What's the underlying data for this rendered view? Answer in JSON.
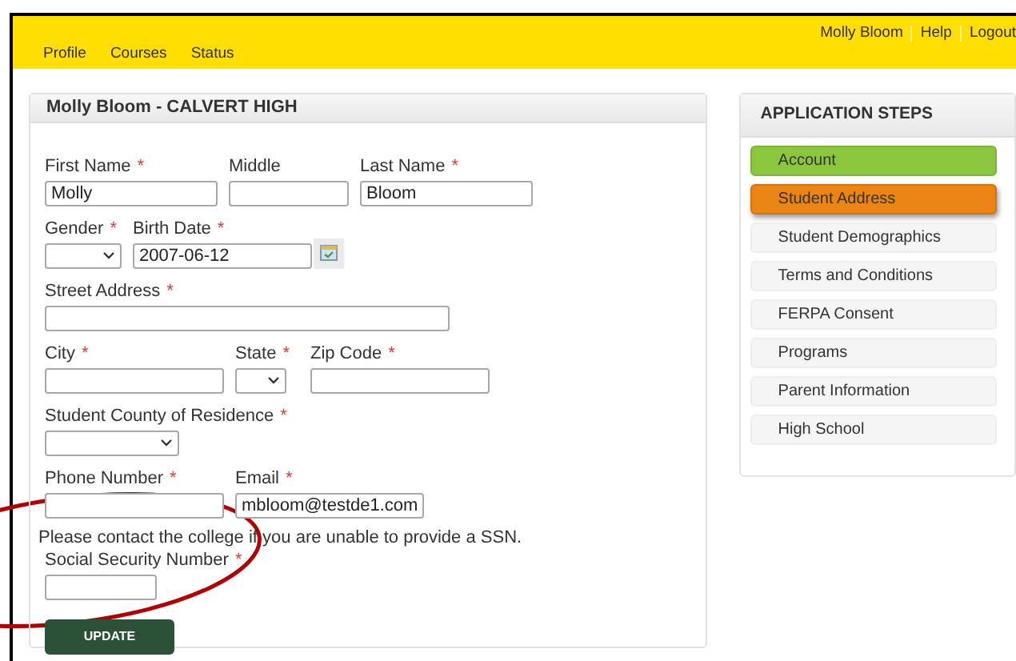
{
  "nav": {
    "links": [
      "Profile",
      "Courses",
      "Status"
    ],
    "user_links": [
      "Molly Bloom",
      "Help",
      "Logout"
    ]
  },
  "form": {
    "title": "Molly Bloom - CALVERT HIGH",
    "rows": [
      {
        "fields": [
          {
            "label": "First Name",
            "required": true,
            "kind": "text",
            "value": "Molly"
          },
          {
            "label": "Middle",
            "required": false,
            "kind": "text"
          },
          {
            "label": "Last Name",
            "required": true,
            "kind": "text",
            "value": "Bloom"
          }
        ]
      },
      {
        "fields": [
          {
            "label": "Gender",
            "required": true,
            "kind": "select"
          },
          {
            "label": "Birth Date",
            "required": true,
            "kind": "date",
            "value": "2007-06-12"
          }
        ]
      },
      {
        "fields": [
          {
            "label": "Street Address",
            "required": true,
            "kind": "text"
          }
        ]
      },
      {
        "fields": [
          {
            "label": "City",
            "required": true,
            "kind": "text"
          },
          {
            "label": "State",
            "required": true,
            "kind": "select"
          },
          {
            "label": "Zip Code",
            "required": true,
            "kind": "text"
          }
        ]
      },
      {
        "fields": [
          {
            "label": "Student County of Residence",
            "required": true,
            "kind": "select"
          }
        ]
      },
      {
        "fields": [
          {
            "label": "Phone Number",
            "required": true,
            "kind": "text"
          },
          {
            "label": "Email",
            "required": true,
            "kind": "text",
            "value": "mbloom@testde1.com"
          }
        ]
      },
      {
        "note": "Please contact the college if you are unable to provide a SSN.",
        "fields": [
          {
            "label": "Social Security Number",
            "required": true,
            "kind": "text"
          }
        ]
      }
    ],
    "required_mark": "*",
    "button": "UPDATE"
  },
  "steps": {
    "title": "APPLICATION STEPS",
    "items": [
      {
        "label": "Account",
        "complete": true,
        "selected": false
      },
      {
        "label": "Student Address",
        "selected": true
      },
      {
        "label": "Student Demographics",
        "complete": false,
        "selected": false
      },
      {
        "label": "Terms and Conditions",
        "complete": false,
        "selected": false
      },
      {
        "label": "FERPA Consent",
        "complete": false,
        "selected": false
      },
      {
        "label": "Programs",
        "complete": false,
        "selected": false
      },
      {
        "label": "Parent Information",
        "complete": false,
        "selected": false
      },
      {
        "label": "High School",
        "complete": false,
        "selected": false
      }
    ]
  }
}
